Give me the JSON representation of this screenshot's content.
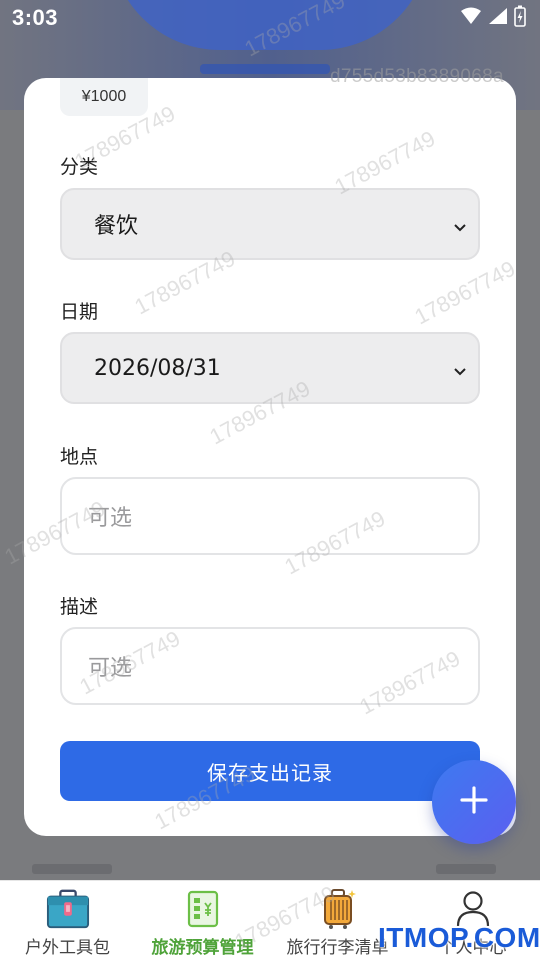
{
  "status_bar": {
    "time": "3:03",
    "icons": [
      "wifi-icon",
      "cellular-icon",
      "battery-charging-icon"
    ]
  },
  "watermark": {
    "text": "178967749",
    "hash": "d755d53b8389068a"
  },
  "form": {
    "amount": "¥1000",
    "category_label": "分类",
    "category_value": "餐饮",
    "date_label": "日期",
    "date_value": "2026/08/31",
    "location_label": "地点",
    "location_placeholder": "可选",
    "description_label": "描述",
    "description_placeholder": "可选",
    "save_label": "保存支出记录"
  },
  "fab": {
    "icon": "plus-icon"
  },
  "bottom_nav": {
    "items": [
      {
        "label": "户外工具包",
        "icon": "toolbox-icon",
        "active": false
      },
      {
        "label": "旅游预算管理",
        "icon": "budget-icon",
        "active": true
      },
      {
        "label": "旅行行李清单",
        "icon": "luggage-icon",
        "active": false
      },
      {
        "label": "个人中心",
        "icon": "user-icon",
        "active": false
      }
    ]
  },
  "branding": {
    "site": "ITMOP.COM"
  },
  "colors": {
    "primary": "#2e6ae6",
    "active_nav": "#4fa33a",
    "fab": "#3d7af0"
  }
}
